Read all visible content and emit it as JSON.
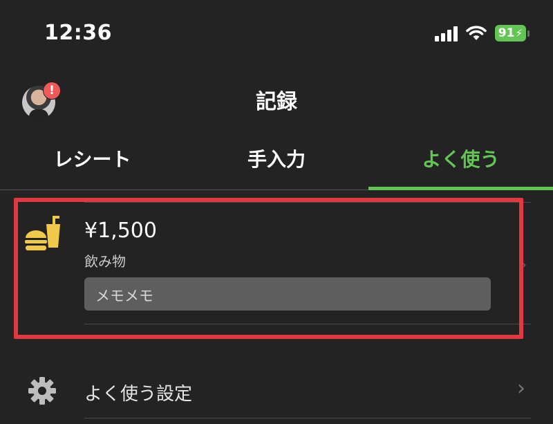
{
  "status_bar": {
    "time": "12:36",
    "battery": "91",
    "icons": [
      "signal-icon",
      "wifi-icon",
      "battery-icon"
    ]
  },
  "header": {
    "title": "記録",
    "avatar_badge": "!"
  },
  "tabs": [
    {
      "label": "レシート",
      "active": false
    },
    {
      "label": "手入力",
      "active": false
    },
    {
      "label": "よく使う",
      "active": true
    }
  ],
  "favorite_entry": {
    "icon": "burger-drink-icon",
    "amount": "¥1,500",
    "category": "飲み物",
    "memo": "メモメモ"
  },
  "settings_row": {
    "icon": "gear-icon",
    "label": "よく使う設定"
  },
  "colors": {
    "background": "#232323",
    "accent": "#62c554",
    "highlight_border": "#e0393f",
    "icon_yellow": "#f1c94a",
    "badge_red": "#ee5a5a"
  }
}
